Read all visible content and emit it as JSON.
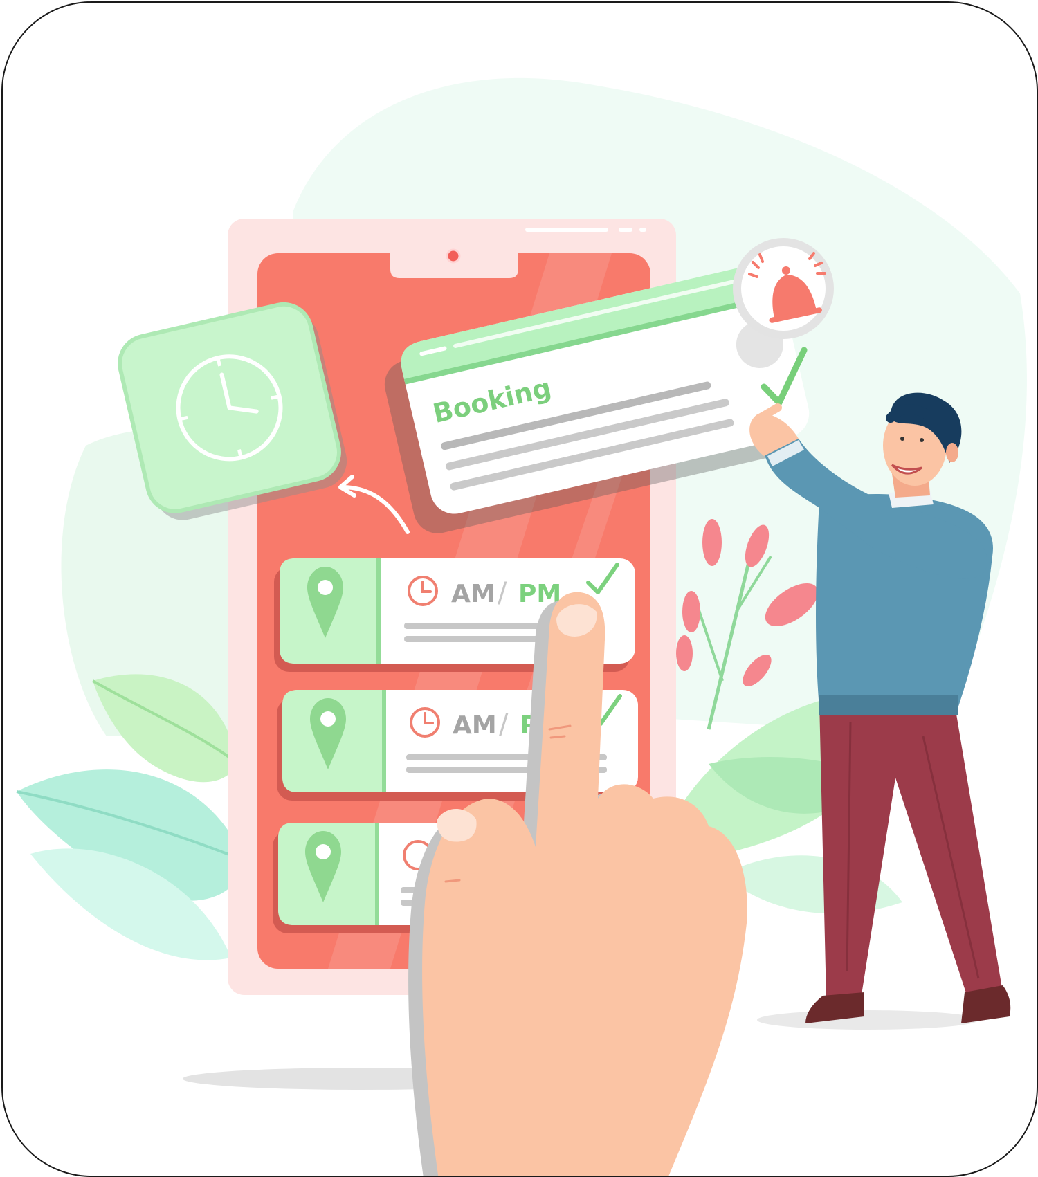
{
  "booking_card": {
    "title": "Booking"
  },
  "schedule_items": [
    {
      "am_label": "AM",
      "separator": "/",
      "pm_label": "PM",
      "checked": true
    },
    {
      "am_label": "AM",
      "separator": "/",
      "pm_label": "P",
      "checked": true
    },
    {
      "am_label": "",
      "separator": "",
      "pm_label": "",
      "checked": false
    }
  ],
  "colors": {
    "accent_green": "#7dd18a",
    "phone_red": "#f87a6b",
    "phone_frame": "#fde4e3",
    "skin": "#fbc4a4",
    "shirt": "#5b97b3",
    "pants": "#9c3b4a"
  },
  "icons": [
    "clock-icon",
    "bell-icon",
    "check-icon",
    "location-pin-icon"
  ]
}
